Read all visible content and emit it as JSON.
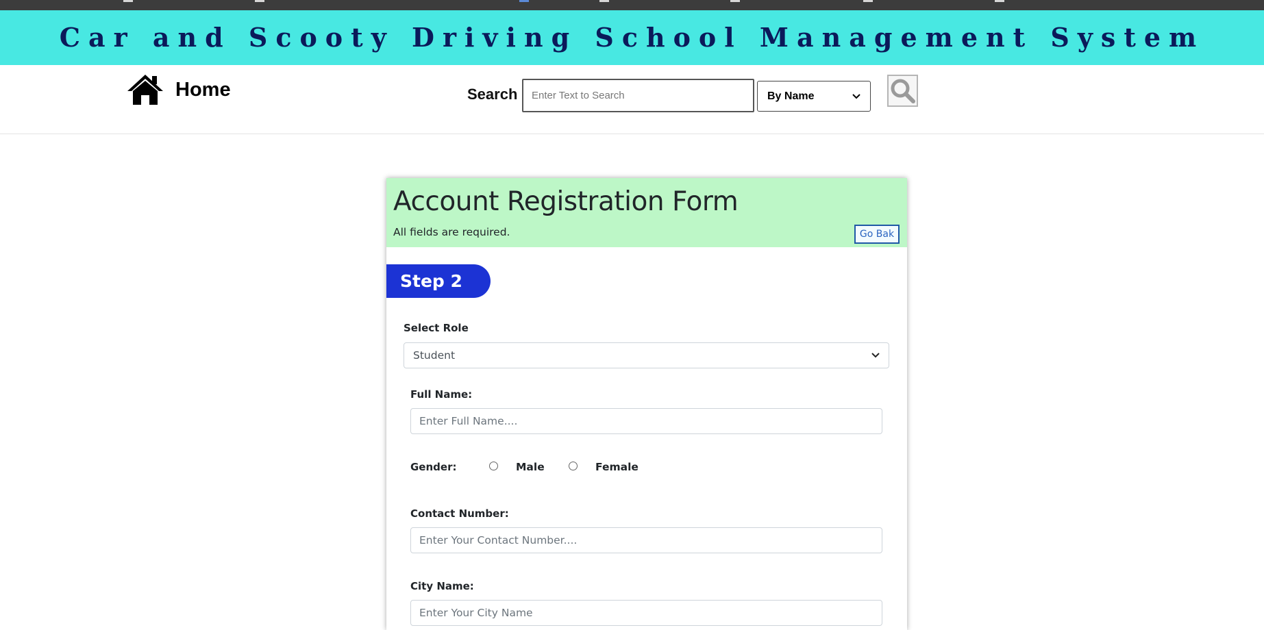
{
  "app": {
    "title": "Car and Scooty Driving School Management System"
  },
  "nav": {
    "home_label": "Home",
    "home_icon": "home-icon",
    "search_label": "Search",
    "search_placeholder": "Enter Text to Search",
    "search_by_selected": "By Name",
    "search_icon": "search-icon"
  },
  "form": {
    "title": "Account Registration Form",
    "subtitle": "All fields are required.",
    "go_back_label": "Go Bak",
    "step_label": "Step 2",
    "role": {
      "label": "Select Role",
      "selected": "Student"
    },
    "full_name": {
      "label": "Full Name:",
      "placeholder": "Enter Full Name...."
    },
    "gender": {
      "label": "Gender:",
      "options": [
        "Male",
        "Female"
      ]
    },
    "contact": {
      "label": "Contact Number:",
      "placeholder": "Enter Your Contact Number...."
    },
    "city": {
      "label": "City Name:",
      "placeholder": "Enter Your City Name"
    }
  },
  "colors": {
    "banner_bg": "#48e8e2",
    "banner_text": "#0b1a5a",
    "form_header_bg": "#bdf7c7",
    "step_bg": "#1c33d4"
  }
}
